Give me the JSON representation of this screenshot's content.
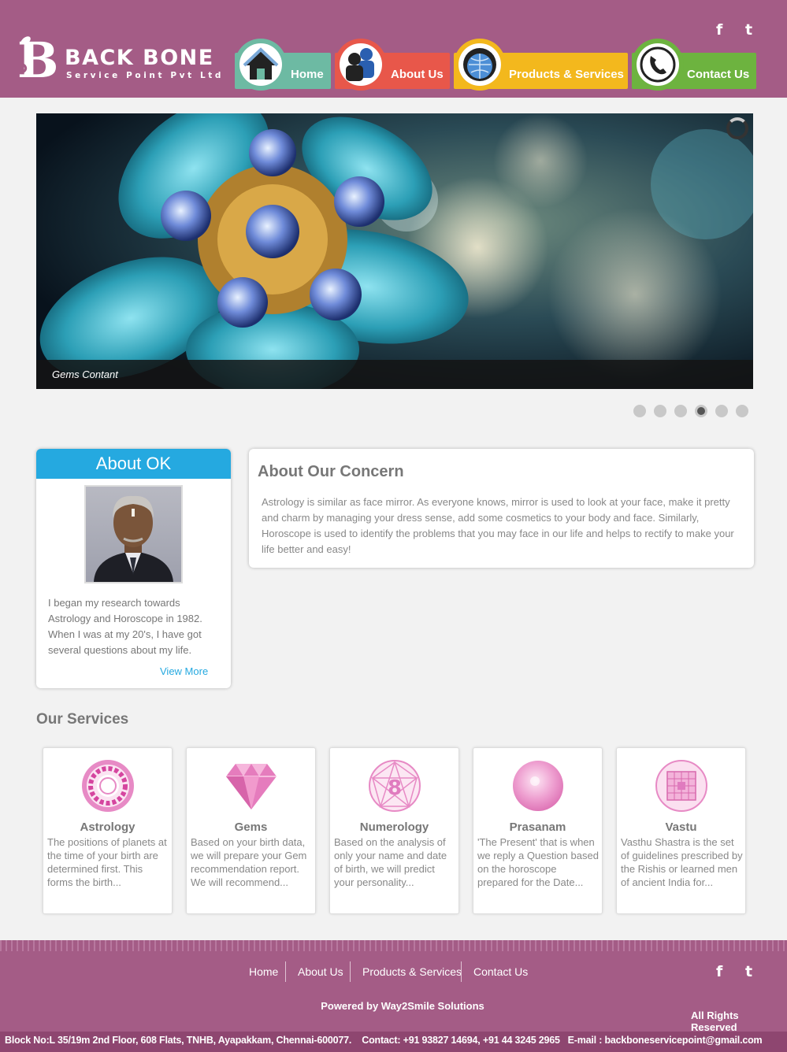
{
  "brand": {
    "name": "BACK BONE",
    "tagline": "Service Point Pvt Ltd"
  },
  "nav": {
    "items": [
      {
        "label": "Home",
        "icon": "home-icon"
      },
      {
        "label": "About Us",
        "icon": "users-icon"
      },
      {
        "label": "Products & Services",
        "icon": "globe-icon"
      },
      {
        "label": "Contact Us",
        "icon": "phone-icon"
      }
    ]
  },
  "social": {
    "facebook": "f",
    "twitter": "t"
  },
  "slider": {
    "caption": "Gems Contant",
    "slide_count": 6,
    "active_index": 3
  },
  "about": {
    "title": "About OK",
    "text": "I began my research towards Astrology and Horoscope in 1982. When I was at my 20's, I have got several questions about my life.",
    "view_more": "View More"
  },
  "concern": {
    "title": "About Our Concern",
    "text": "Astrology is similar as face mirror. As everyone knows, mirror is used to look at your face, make it pretty and charm by managing your dress sense, add some cosmetics to your body and face. Similarly, Horoscope is used to identify the problems that you may face in our life and helps to rectify to make your life better and easy!"
  },
  "services": {
    "title": "Our Services",
    "items": [
      {
        "name": "Astrology",
        "desc": "The positions of planets at the time of your birth are determined first. This forms the birth...",
        "icon": "zodiac-wheel-icon"
      },
      {
        "name": "Gems",
        "desc": "Based on your birth data, we will prepare your Gem recommendation report. We will recommend...",
        "icon": "gem-icon"
      },
      {
        "name": "Numerology",
        "desc": "Based on the analysis of only your name and date of birth, we will predict your personality...",
        "icon": "numerology-icon"
      },
      {
        "name": "Prasanam",
        "desc": "'The Present' that is when we reply a Question based on the horoscope prepared for the Date...",
        "icon": "sphere-icon"
      },
      {
        "name": "Vastu",
        "desc": "Vasthu Shastra is the set of guidelines prescribed by the Rishis or learned men of ancient India for...",
        "icon": "vastu-grid-icon"
      }
    ]
  },
  "footer": {
    "links": [
      "Home",
      "About Us",
      "Products & Services",
      "Contact Us"
    ],
    "powered": "Powered by Way2Smile Solutions",
    "rights": "All Rights Reserved",
    "address": "Block No:L 35/19m 2nd Floor, 608 Flats, TNHB, Ayapakkam, Chennai-600077.",
    "contact": "Contact: +91 93827 14694, +91 44 3245 2965",
    "email": "E-mail : backboneservicepoint@gmail.com"
  },
  "colors": {
    "header_bg": "#a45c86",
    "home": "#6dbaa3",
    "about": "#e8574a",
    "products": "#f3b81d",
    "contact": "#6db33f",
    "accent_blue": "#25a9e0",
    "service_pink": "#e07bbf"
  }
}
